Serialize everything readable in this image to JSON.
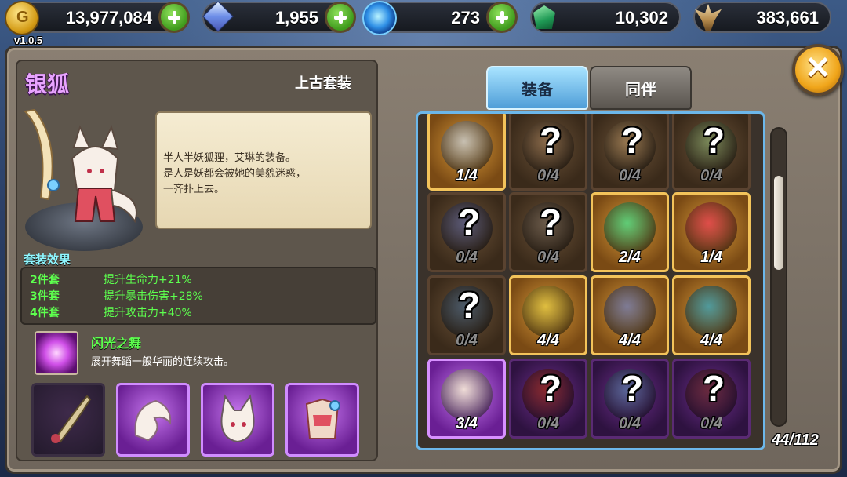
{
  "version": "v1.0.5",
  "resources": {
    "gold": "13,977,084",
    "gems": "1,955",
    "orbs": "273",
    "jade": "10,302",
    "crest": "383,661"
  },
  "close_label": "✕",
  "set": {
    "name": "银狐",
    "type": "上古套装",
    "description": "半人半妖狐狸，艾琳的装备。\n是人是妖都会被她的美貌迷惑，\n一齐扑上去。",
    "bonus_title": "套装效果",
    "bonuses": [
      {
        "count": "2件套",
        "effect": "提升生命力+21%"
      },
      {
        "count": "3件套",
        "effect": "提升暴击伤害+28%"
      },
      {
        "count": "4件套",
        "effect": "提升攻击力+40%"
      }
    ],
    "skill": {
      "name": "闪光之舞",
      "description": "展开舞蹈一般华丽的连续攻击。"
    }
  },
  "tabs": {
    "equipment": "装备",
    "companion": "同伴"
  },
  "grid": [
    {
      "frac": "1/4",
      "style": "gold",
      "locked": false,
      "color": "#c7c2b8"
    },
    {
      "frac": "0/4",
      "style": "brown",
      "locked": true,
      "color": "#8a6a4a"
    },
    {
      "frac": "0/4",
      "style": "brown",
      "locked": true,
      "color": "#9b7a52"
    },
    {
      "frac": "0/4",
      "style": "brown",
      "locked": true,
      "color": "#7a8a5a"
    },
    {
      "frac": "0/4",
      "style": "brown",
      "locked": true,
      "color": "#5a5a7a"
    },
    {
      "frac": "0/4",
      "style": "brown",
      "locked": true,
      "color": "#6a5a4a"
    },
    {
      "frac": "2/4",
      "style": "gold",
      "locked": false,
      "color": "#5ad07a"
    },
    {
      "frac": "1/4",
      "style": "gold",
      "locked": false,
      "color": "#e04a4a"
    },
    {
      "frac": "0/4",
      "style": "brown",
      "locked": true,
      "color": "#4a5a6a"
    },
    {
      "frac": "4/4",
      "style": "gold",
      "locked": false,
      "color": "#e0c040"
    },
    {
      "frac": "4/4",
      "style": "gold",
      "locked": false,
      "color": "#7a7a9a"
    },
    {
      "frac": "4/4",
      "style": "gold",
      "locked": false,
      "color": "#4a9aa0"
    },
    {
      "frac": "3/4",
      "style": "purple-lit",
      "locked": false,
      "color": "#f2e2d6"
    },
    {
      "frac": "0/4",
      "style": "purple",
      "locked": true,
      "color": "#8a2a2a"
    },
    {
      "frac": "0/4",
      "style": "purple",
      "locked": true,
      "color": "#5a6a9a"
    },
    {
      "frac": "0/4",
      "style": "purple",
      "locked": true,
      "color": "#6a2a3a"
    }
  ],
  "counter": "44/112"
}
